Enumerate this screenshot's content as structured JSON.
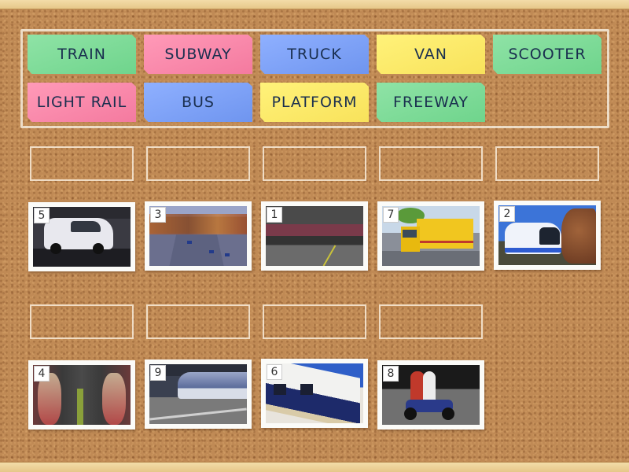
{
  "game": {
    "type": "drag-labels-onto-images",
    "word_bank": [
      {
        "label": "TRAIN",
        "color": "green"
      },
      {
        "label": "SUBWAY",
        "color": "pink"
      },
      {
        "label": "TRUCK",
        "color": "blue"
      },
      {
        "label": "VAN",
        "color": "yellow"
      },
      {
        "label": "SCOOTER",
        "color": "green"
      },
      {
        "label": "LIGHT RAIL",
        "color": "pink"
      },
      {
        "label": "BUS",
        "color": "blue"
      },
      {
        "label": "PLATFORM",
        "color": "yellow"
      },
      {
        "label": "FREEWAY",
        "color": "green"
      }
    ],
    "images": [
      {
        "number": "5",
        "depicts": "van"
      },
      {
        "number": "3",
        "depicts": "freeway"
      },
      {
        "number": "1",
        "depicts": "platform"
      },
      {
        "number": "7",
        "depicts": "truck"
      },
      {
        "number": "2",
        "depicts": "bus"
      },
      {
        "number": "4",
        "depicts": "subway"
      },
      {
        "number": "9",
        "depicts": "light rail"
      },
      {
        "number": "6",
        "depicts": "train"
      },
      {
        "number": "8",
        "depicts": "scooter"
      }
    ],
    "drop_slots": [
      {
        "value": ""
      },
      {
        "value": ""
      },
      {
        "value": ""
      },
      {
        "value": ""
      },
      {
        "value": ""
      },
      {
        "value": ""
      },
      {
        "value": ""
      },
      {
        "value": ""
      },
      {
        "value": ""
      }
    ]
  },
  "colors": {
    "green": "#7fdc9a",
    "pink": "#f98aac",
    "blue": "#7fa3f7",
    "yellow": "#fbe96a",
    "text": "#1a2f4f",
    "cork": "#c08a55",
    "frame": "#efd6a0"
  }
}
